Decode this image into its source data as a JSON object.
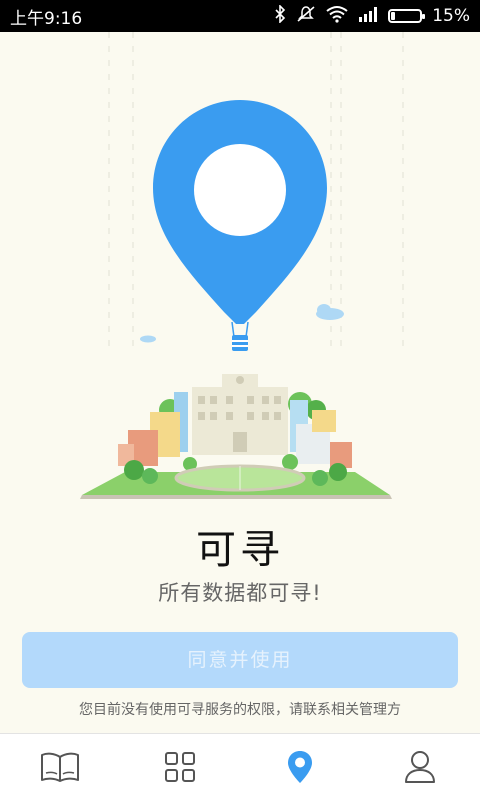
{
  "status_bar": {
    "time": "上午9:16",
    "battery_percent": "15%",
    "battery_level": 0.15,
    "icons": [
      "bluetooth-icon",
      "silent-icon",
      "wifi-icon",
      "signal-icon",
      "battery-icon"
    ]
  },
  "main": {
    "title": "可寻",
    "subtitle": "所有数据都可寻!",
    "agree_button_label": "同意并使用",
    "notice": "您目前没有使用可寻服务的权限，请联系相关管理方"
  },
  "tabbar": {
    "tabs": [
      {
        "icon": "book-icon",
        "active": false
      },
      {
        "icon": "grid-icon",
        "active": false
      },
      {
        "icon": "location-pin-icon",
        "active": true
      },
      {
        "icon": "user-icon",
        "active": false
      }
    ]
  },
  "colors": {
    "accent": "#3a9cf0",
    "button_disabled": "#b3d9fb",
    "background": "#fbfaf0",
    "inactive_icon": "#555555"
  }
}
